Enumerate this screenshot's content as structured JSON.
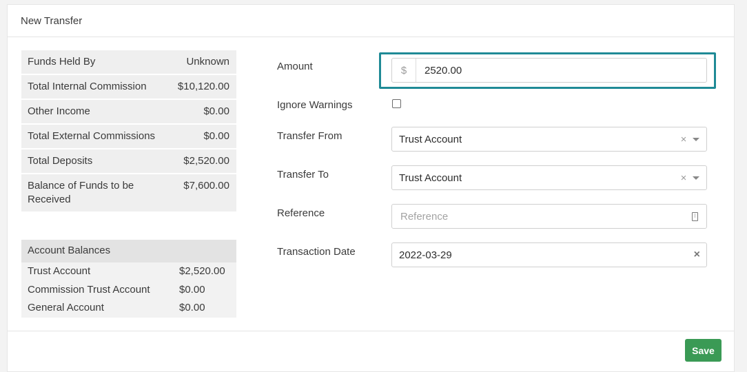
{
  "header": {
    "title": "New Transfer"
  },
  "summary": {
    "rows": [
      {
        "label": "Funds Held By",
        "value": "Unknown"
      },
      {
        "label": "Total Internal Commission",
        "value": "$10,120.00"
      },
      {
        "label": "Other Income",
        "value": "$0.00"
      },
      {
        "label": "Total External Commissions",
        "value": "$0.00"
      },
      {
        "label": "Total Deposits",
        "value": "$2,520.00"
      },
      {
        "label": "Balance of Funds to be Received",
        "value": "$7,600.00"
      }
    ]
  },
  "balances": {
    "title": "Account Balances",
    "rows": [
      {
        "label": "Trust Account",
        "value": "$2,520.00"
      },
      {
        "label": "Commission Trust Account",
        "value": "$0.00"
      },
      {
        "label": "General Account",
        "value": "$0.00"
      }
    ]
  },
  "form": {
    "amount": {
      "label": "Amount",
      "prefix": "$",
      "value": "2520.00"
    },
    "ignore_warnings": {
      "label": "Ignore Warnings",
      "checked": false
    },
    "transfer_from": {
      "label": "Transfer From",
      "value": "Trust Account",
      "clear": "×"
    },
    "transfer_to": {
      "label": "Transfer To",
      "value": "Trust Account",
      "clear": "×"
    },
    "reference": {
      "label": "Reference",
      "placeholder": "Reference"
    },
    "transaction_date": {
      "label": "Transaction Date",
      "value": "2022-03-29",
      "clear": "×"
    }
  },
  "footer": {
    "save_label": "Save"
  },
  "colors": {
    "focus": "#1f8a96",
    "save": "#3a9a55"
  }
}
